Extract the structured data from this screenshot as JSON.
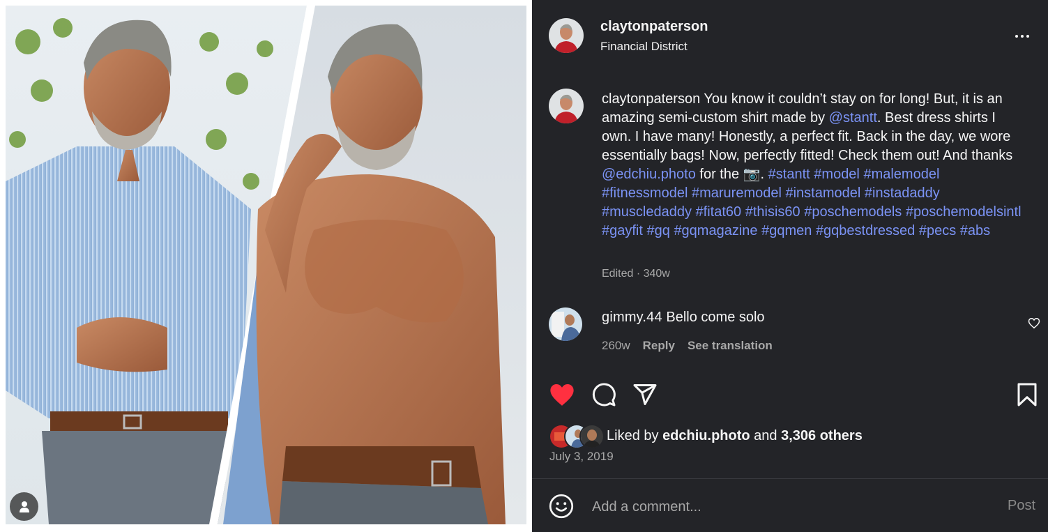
{
  "post": {
    "username": "claytonpaterson",
    "location": "Financial District"
  },
  "caption": {
    "username": "claytonpaterson",
    "text1": "You know it couldn’t stay on for long! But, it is an amazing semi-custom shirt made by ",
    "mention1": "@stantt",
    "text2": ". Best dress shirts I own. I have many! Honestly, a perfect fit. Back in the day, we wore essentially bags! Now, perfectly fitted! Check them out! And thanks ",
    "mention2": "@edchiu.photo",
    "text3": " for the 📷. ",
    "hashtags": [
      "#stantt",
      "#model",
      "#malemodel",
      "#fitnessmodel",
      "#maruremodel",
      "#instamodel",
      "#instadaddy",
      "#muscledaddy",
      "#fitat60",
      "#thisis60",
      "#poschemodels",
      "#poschemodelsintl",
      "#gayfit",
      "#gq",
      "#gqmagazine",
      "#gqmen",
      "#gqbestdressed",
      "#pecs",
      "#abs"
    ],
    "edited": "Edited · 340w"
  },
  "comment": {
    "username": "gimmy.44",
    "text": "Bello come solo",
    "age": "260w",
    "reply": "Reply",
    "translate": "See translation"
  },
  "likes": {
    "prefix": "Liked by ",
    "liker": "edchiu.photo",
    "and": " and ",
    "others": "3,306 others"
  },
  "date": "July 3, 2019",
  "comment_box": {
    "placeholder": "Add a comment...",
    "post_label": "Post"
  },
  "colors": {
    "panel_bg": "#232428",
    "link": "#7b93f5",
    "like_red": "#ff3040",
    "muted": "#a8a8a8"
  },
  "icons": [
    "user-tag-icon",
    "more-options-icon",
    "like-heart-icon",
    "comment-icon",
    "share-icon",
    "save-icon",
    "comment-like-icon",
    "emoji-icon"
  ]
}
